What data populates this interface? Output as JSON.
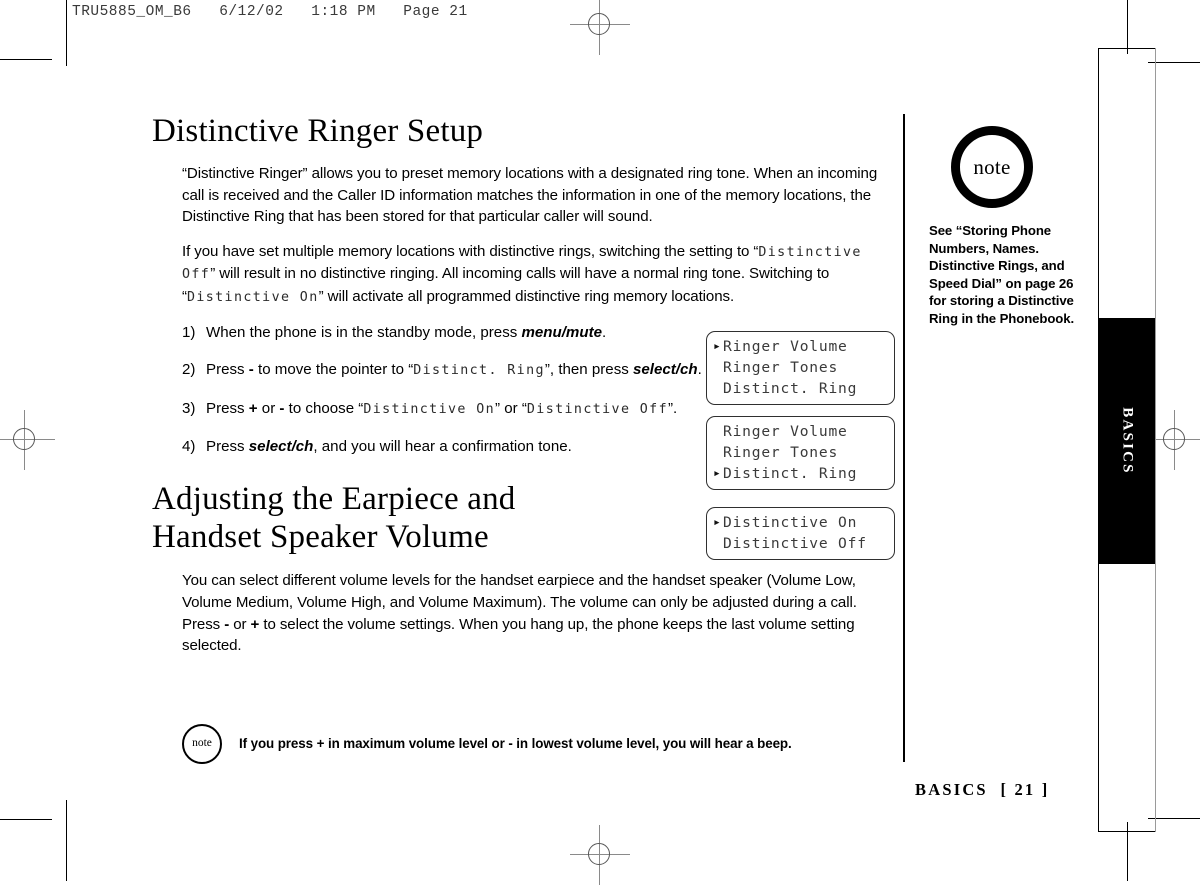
{
  "print_marks": {
    "slug": "TRU5885_OM_B6   6/12/02   1:18 PM   Page 21"
  },
  "side_tab": {
    "label": "BASICS"
  },
  "sections": [
    {
      "heading": "Distinctive Ringer Setup",
      "paragraph_1": {
        "part_1": "“Distinctive Ringer” allows you to preset memory locations with a designated ring tone. When an incoming call is received and the Caller ID information matches the information in one of the memory locations, the Distinctive Ring that has been stored for that particular caller will sound."
      },
      "paragraph_2": {
        "part_1": "If you have set multiple memory locations with distinctive rings, switching the setting to “",
        "lcd_1": "Distinctive Off",
        "part_2": "” will result in no distinctive ringing. All incoming calls will have a normal ring tone. Switching to “",
        "lcd_2": "Distinctive On",
        "part_3": "” will activate all programmed distinctive ring memory locations."
      }
    },
    {
      "heading_line_1": "Adjusting the Earpiece and",
      "heading_line_2": "Handset Speaker Volume",
      "paragraph": {
        "part_1": "You can select different volume levels for the handset earpiece and the handset speaker (Volume Low, Volume Medium, Volume High, and Volume Maximum). The volume can only be adjusted during a call. Press ",
        "minus": "-",
        "part_2": " or ",
        "plus": "+",
        "part_3": " to select the volume settings. When you hang up, the phone keeps the last volume setting selected."
      }
    }
  ],
  "steps": [
    {
      "num": "1)",
      "part_1": "When the phone is in the standby mode, press ",
      "key_1": "menu/mute",
      "part_2": "."
    },
    {
      "num": "2)",
      "part_1": "Press ",
      "sym_1": "-",
      "part_2": " to move the pointer to “",
      "lcd_1": "Distinct. Ring",
      "part_3": "”, then press ",
      "key_1": "select/ch",
      "part_4": "."
    },
    {
      "num": "3)",
      "part_1": "Press ",
      "sym_1": "+",
      "part_2": " or ",
      "sym_2": "-",
      "part_3": " to choose “",
      "lcd_1": "Distinctive On",
      "part_4": "” or “",
      "lcd_2": "Distinctive Off",
      "part_5": "”."
    },
    {
      "num": "4)",
      "part_1": "Press ",
      "key_1": "select/ch",
      "part_2": ", and you will hear a confirmation tone."
    }
  ],
  "lcd_screens": [
    {
      "rows": [
        {
          "pointer": "▸",
          "text": "Ringer Volume"
        },
        {
          "pointer": "",
          "text": "Ringer Tones"
        },
        {
          "pointer": "",
          "text": "Distinct. Ring"
        }
      ]
    },
    {
      "rows": [
        {
          "pointer": "",
          "text": "Ringer Volume"
        },
        {
          "pointer": "",
          "text": "Ringer Tones"
        },
        {
          "pointer": "▸",
          "text": "Distinct. Ring"
        }
      ]
    },
    {
      "rows": [
        {
          "pointer": "▸",
          "text": "Distinctive On"
        },
        {
          "pointer": "",
          "text": "Distinctive Off"
        }
      ]
    }
  ],
  "side_note": {
    "badge_label": "note",
    "text": "See “Storing Phone Numbers, Names. Distinctive Rings, and Speed Dial” on page 26 for storing a Distinctive Ring in the Phonebook."
  },
  "bottom_note": {
    "badge_label": "note",
    "part_1": "If you press ",
    "plus": "+",
    "part_2": " in maximum volume level or ",
    "minus": "-",
    "part_3": " in lowest volume level, you will hear a beep."
  },
  "footer": {
    "text": "BASICS  [ 21 ]"
  }
}
